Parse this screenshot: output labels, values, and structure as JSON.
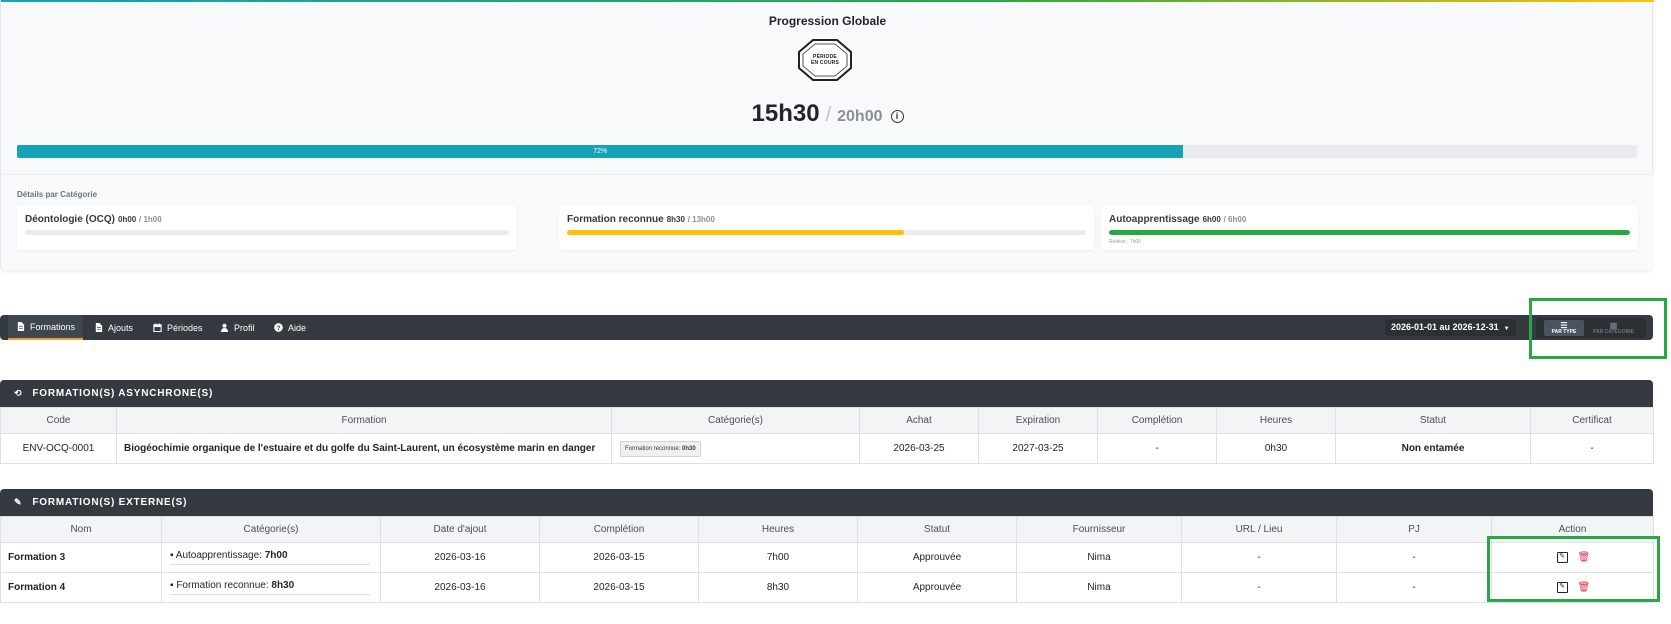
{
  "progress": {
    "title": "Progression Globale",
    "badge_line1": "PÉRIODE",
    "badge_line2": "EN COURS",
    "hours_done": "15h30",
    "hours_separator": "/",
    "hours_target": "20h00",
    "percent_label": "72%",
    "percent": 72,
    "details_title": "Détails par Catégorie",
    "categories": [
      {
        "name": "Déontologie (OCQ)",
        "done": "0h00",
        "target": "/ 1h00",
        "fraction": 0,
        "color": "#e9ecef",
        "sub": ""
      },
      {
        "name": "Formation reconnue",
        "done": "8h30",
        "target": "/ 13h00",
        "fraction": 0.65,
        "color": "#ffc107",
        "sub": ""
      },
      {
        "name": "Autoapprentissage",
        "done": "6h00",
        "target": "/ 6h00",
        "fraction": 1,
        "color": "#28a745",
        "sub": "Réalisé : 7h00"
      }
    ]
  },
  "nav": {
    "tabs": [
      {
        "label": "Formations",
        "icon": "document-icon",
        "active": true
      },
      {
        "label": "Ajouts",
        "icon": "document-icon"
      },
      {
        "label": "Périodes",
        "icon": "calendar-icon"
      },
      {
        "label": "Profil",
        "icon": "user-icon"
      },
      {
        "label": "Aide",
        "icon": "help-icon"
      }
    ],
    "date_range": "2026-01-01 au 2026-12-31",
    "view_by_type": "PAR TYPE",
    "view_by_category": "PAR CATÉGORIE"
  },
  "async_section": {
    "title": "FORMATION(S) ASYNCHRONE(S)",
    "columns": [
      "Code",
      "Formation",
      "Catégorie(s)",
      "Achat",
      "Expiration",
      "Complétion",
      "Heures",
      "Statut",
      "Certificat"
    ],
    "rows": [
      {
        "code": "ENV-OCQ-0001",
        "formation": "Biogéochimie organique de l'estuaire et du golfe du Saint-Laurent, un écosystème marin en danger",
        "category_label": "Formation reconnue:",
        "category_hours": "0h30",
        "achat": "2026-03-25",
        "expiration": "2027-03-25",
        "completion": "-",
        "heures": "0h30",
        "statut": "Non entamée",
        "certificat": "-"
      }
    ]
  },
  "external_section": {
    "title": "FORMATION(S) EXTERNE(S)",
    "columns": [
      "Nom",
      "Catégorie(s)",
      "Date d'ajout",
      "Complétion",
      "Heures",
      "Statut",
      "Fournisseur",
      "URL / Lieu",
      "PJ",
      "Action"
    ],
    "rows": [
      {
        "nom": "Formation 3",
        "category_label": "Autoapprentissage:",
        "category_hours": "7h00",
        "date_ajout": "2026-03-16",
        "completion": "2026-03-15",
        "heures": "7h00",
        "statut": "Approuvée",
        "fournisseur": "Nima",
        "url": "-",
        "pj": "-"
      },
      {
        "nom": "Formation 4",
        "category_label": "Formation reconnue:",
        "category_hours": "8h30",
        "date_ajout": "2026-03-16",
        "completion": "2026-03-15",
        "heures": "8h30",
        "statut": "Approuvée",
        "fournisseur": "Nima",
        "url": "-",
        "pj": "-"
      }
    ]
  },
  "colors": {
    "accent": "#17a2b8",
    "dark_header": "#343a40",
    "highlight": "#28a745",
    "warning": "#ffc107",
    "danger": "#dc3545"
  }
}
